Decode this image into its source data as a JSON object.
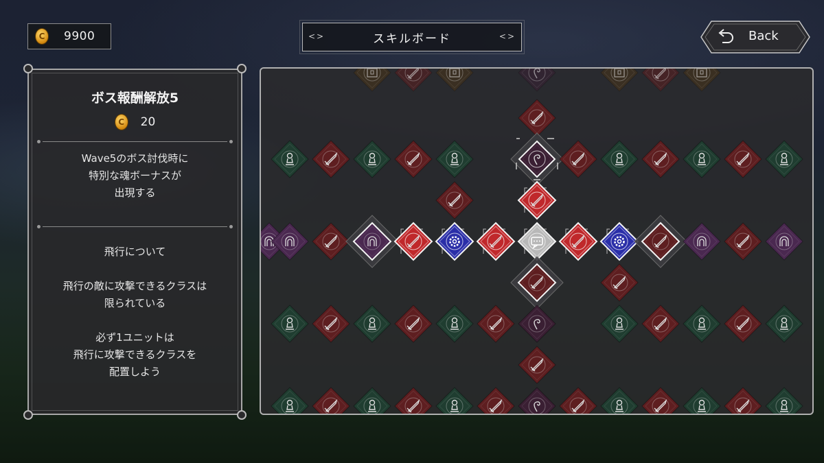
{
  "currency": {
    "amount": "9900",
    "icon": "coin-icon",
    "coin_letter": "C"
  },
  "header": {
    "title": "スキルボード"
  },
  "back_button": {
    "label": "Back",
    "icon": "back-arrow-icon"
  },
  "skill_detail": {
    "name": "ボス報酬解放5",
    "cost": "20",
    "description": "Wave5のボス討伐時に\n特別な魂ボーナスが\n出現する",
    "hint": "飛行について\n\n飛行の敵に攻撃できるクラスは\n限られている\n\n必ず1ユニットは\n飛行に攻撃できるクラスを\n配置しよう"
  },
  "colors": {
    "sword": "#5e1e20",
    "sword_active": "#c0282b",
    "pawn": "#1f3d30",
    "gear_active": "#2a2ea8",
    "soul": "#3a1f33",
    "aura": "#4a2850",
    "chest": "#4a3418",
    "chat_active": "#b8b8b8"
  },
  "skill_board": {
    "nodes": [
      {
        "col": 2,
        "row": -0.1,
        "icon": "chest",
        "state": "dim"
      },
      {
        "col": 3,
        "row": -0.1,
        "icon": "sword",
        "state": "dim"
      },
      {
        "col": 4,
        "row": -0.1,
        "icon": "chest",
        "state": "dim"
      },
      {
        "col": 6,
        "row": -0.1,
        "icon": "soul",
        "state": "dim"
      },
      {
        "col": 8,
        "row": -0.1,
        "icon": "chest",
        "state": "dim"
      },
      {
        "col": 9,
        "row": -0.1,
        "icon": "sword",
        "state": "dim"
      },
      {
        "col": 10,
        "row": -0.1,
        "icon": "chest",
        "state": "dim"
      },
      {
        "col": 6,
        "row": 1,
        "icon": "sword",
        "state": "normal"
      },
      {
        "col": 0,
        "row": 2,
        "icon": "pawn",
        "state": "normal"
      },
      {
        "col": 1,
        "row": 2,
        "icon": "sword",
        "state": "normal"
      },
      {
        "col": 2,
        "row": 2,
        "icon": "pawn",
        "state": "normal"
      },
      {
        "col": 3,
        "row": 2,
        "icon": "sword",
        "state": "normal"
      },
      {
        "col": 4,
        "row": 2,
        "icon": "pawn",
        "state": "normal"
      },
      {
        "col": 6,
        "row": 2,
        "icon": "soul",
        "state": "selected"
      },
      {
        "col": 7,
        "row": 2,
        "icon": "sword",
        "state": "normal"
      },
      {
        "col": 8,
        "row": 2,
        "icon": "pawn",
        "state": "normal"
      },
      {
        "col": 9,
        "row": 2,
        "icon": "sword",
        "state": "normal"
      },
      {
        "col": 10,
        "row": 2,
        "icon": "pawn",
        "state": "normal"
      },
      {
        "col": 11,
        "row": 2,
        "icon": "sword",
        "state": "normal"
      },
      {
        "col": 12,
        "row": 2,
        "icon": "pawn",
        "state": "normal"
      },
      {
        "col": 4,
        "row": 3,
        "icon": "sword",
        "state": "normal"
      },
      {
        "col": 6,
        "row": 3,
        "icon": "sword",
        "state": "active"
      },
      {
        "col": -0.5,
        "row": 4,
        "icon": "aura",
        "state": "normal"
      },
      {
        "col": 0,
        "row": 4,
        "icon": "aura",
        "state": "normal"
      },
      {
        "col": 1,
        "row": 4,
        "icon": "sword",
        "state": "normal"
      },
      {
        "col": 2,
        "row": 4,
        "icon": "aura",
        "state": "unlocked"
      },
      {
        "col": 3,
        "row": 4,
        "icon": "sword",
        "state": "active"
      },
      {
        "col": 4,
        "row": 4,
        "icon": "gear",
        "state": "active"
      },
      {
        "col": 5,
        "row": 4,
        "icon": "sword",
        "state": "active"
      },
      {
        "col": 6,
        "row": 4,
        "icon": "chat",
        "state": "active"
      },
      {
        "col": 7,
        "row": 4,
        "icon": "sword",
        "state": "active"
      },
      {
        "col": 8,
        "row": 4,
        "icon": "gear",
        "state": "active"
      },
      {
        "col": 9,
        "row": 4,
        "icon": "sword",
        "state": "unlocked"
      },
      {
        "col": 10,
        "row": 4,
        "icon": "aura",
        "state": "normal"
      },
      {
        "col": 11,
        "row": 4,
        "icon": "sword",
        "state": "normal"
      },
      {
        "col": 12,
        "row": 4,
        "icon": "aura",
        "state": "normal"
      },
      {
        "col": 6,
        "row": 5,
        "icon": "sword",
        "state": "unlocked"
      },
      {
        "col": 8,
        "row": 5,
        "icon": "sword",
        "state": "normal"
      },
      {
        "col": 0,
        "row": 6,
        "icon": "pawn",
        "state": "normal"
      },
      {
        "col": 1,
        "row": 6,
        "icon": "sword",
        "state": "normal"
      },
      {
        "col": 2,
        "row": 6,
        "icon": "pawn",
        "state": "normal"
      },
      {
        "col": 3,
        "row": 6,
        "icon": "sword",
        "state": "normal"
      },
      {
        "col": 4,
        "row": 6,
        "icon": "pawn",
        "state": "normal"
      },
      {
        "col": 5,
        "row": 6,
        "icon": "sword",
        "state": "normal"
      },
      {
        "col": 6,
        "row": 6,
        "icon": "soul",
        "state": "normal"
      },
      {
        "col": 8,
        "row": 6,
        "icon": "pawn",
        "state": "normal"
      },
      {
        "col": 9,
        "row": 6,
        "icon": "sword",
        "state": "normal"
      },
      {
        "col": 10,
        "row": 6,
        "icon": "pawn",
        "state": "normal"
      },
      {
        "col": 11,
        "row": 6,
        "icon": "sword",
        "state": "normal"
      },
      {
        "col": 12,
        "row": 6,
        "icon": "pawn",
        "state": "normal"
      },
      {
        "col": 6,
        "row": 7,
        "icon": "sword",
        "state": "normal"
      },
      {
        "col": 0,
        "row": 8,
        "icon": "pawn",
        "state": "normal"
      },
      {
        "col": 1,
        "row": 8,
        "icon": "sword",
        "state": "normal"
      },
      {
        "col": 2,
        "row": 8,
        "icon": "pawn",
        "state": "normal"
      },
      {
        "col": 3,
        "row": 8,
        "icon": "sword",
        "state": "normal"
      },
      {
        "col": 4,
        "row": 8,
        "icon": "pawn",
        "state": "normal"
      },
      {
        "col": 5,
        "row": 8,
        "icon": "sword",
        "state": "normal"
      },
      {
        "col": 6,
        "row": 8,
        "icon": "soul",
        "state": "normal"
      },
      {
        "col": 7,
        "row": 8,
        "icon": "sword",
        "state": "normal"
      },
      {
        "col": 8,
        "row": 8,
        "icon": "pawn",
        "state": "normal"
      },
      {
        "col": 9,
        "row": 8,
        "icon": "sword",
        "state": "normal"
      },
      {
        "col": 10,
        "row": 8,
        "icon": "pawn",
        "state": "normal"
      },
      {
        "col": 11,
        "row": 8,
        "icon": "sword",
        "state": "normal"
      },
      {
        "col": 12,
        "row": 8,
        "icon": "pawn",
        "state": "normal"
      }
    ]
  }
}
